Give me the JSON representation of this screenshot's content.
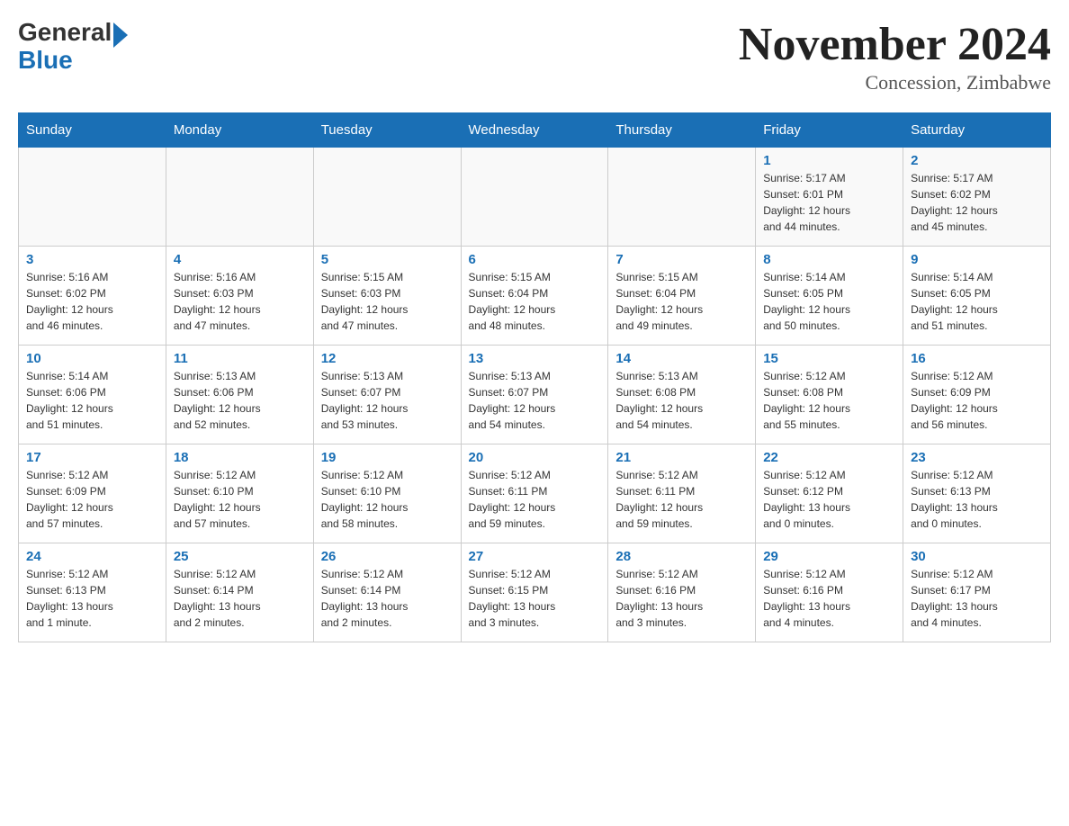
{
  "header": {
    "logo_general": "General",
    "logo_blue": "Blue",
    "month_title": "November 2024",
    "location": "Concession, Zimbabwe"
  },
  "weekdays": [
    "Sunday",
    "Monday",
    "Tuesday",
    "Wednesday",
    "Thursday",
    "Friday",
    "Saturday"
  ],
  "weeks": [
    [
      {
        "day": "",
        "info": ""
      },
      {
        "day": "",
        "info": ""
      },
      {
        "day": "",
        "info": ""
      },
      {
        "day": "",
        "info": ""
      },
      {
        "day": "",
        "info": ""
      },
      {
        "day": "1",
        "info": "Sunrise: 5:17 AM\nSunset: 6:01 PM\nDaylight: 12 hours\nand 44 minutes."
      },
      {
        "day": "2",
        "info": "Sunrise: 5:17 AM\nSunset: 6:02 PM\nDaylight: 12 hours\nand 45 minutes."
      }
    ],
    [
      {
        "day": "3",
        "info": "Sunrise: 5:16 AM\nSunset: 6:02 PM\nDaylight: 12 hours\nand 46 minutes."
      },
      {
        "day": "4",
        "info": "Sunrise: 5:16 AM\nSunset: 6:03 PM\nDaylight: 12 hours\nand 47 minutes."
      },
      {
        "day": "5",
        "info": "Sunrise: 5:15 AM\nSunset: 6:03 PM\nDaylight: 12 hours\nand 47 minutes."
      },
      {
        "day": "6",
        "info": "Sunrise: 5:15 AM\nSunset: 6:04 PM\nDaylight: 12 hours\nand 48 minutes."
      },
      {
        "day": "7",
        "info": "Sunrise: 5:15 AM\nSunset: 6:04 PM\nDaylight: 12 hours\nand 49 minutes."
      },
      {
        "day": "8",
        "info": "Sunrise: 5:14 AM\nSunset: 6:05 PM\nDaylight: 12 hours\nand 50 minutes."
      },
      {
        "day": "9",
        "info": "Sunrise: 5:14 AM\nSunset: 6:05 PM\nDaylight: 12 hours\nand 51 minutes."
      }
    ],
    [
      {
        "day": "10",
        "info": "Sunrise: 5:14 AM\nSunset: 6:06 PM\nDaylight: 12 hours\nand 51 minutes."
      },
      {
        "day": "11",
        "info": "Sunrise: 5:13 AM\nSunset: 6:06 PM\nDaylight: 12 hours\nand 52 minutes."
      },
      {
        "day": "12",
        "info": "Sunrise: 5:13 AM\nSunset: 6:07 PM\nDaylight: 12 hours\nand 53 minutes."
      },
      {
        "day": "13",
        "info": "Sunrise: 5:13 AM\nSunset: 6:07 PM\nDaylight: 12 hours\nand 54 minutes."
      },
      {
        "day": "14",
        "info": "Sunrise: 5:13 AM\nSunset: 6:08 PM\nDaylight: 12 hours\nand 54 minutes."
      },
      {
        "day": "15",
        "info": "Sunrise: 5:12 AM\nSunset: 6:08 PM\nDaylight: 12 hours\nand 55 minutes."
      },
      {
        "day": "16",
        "info": "Sunrise: 5:12 AM\nSunset: 6:09 PM\nDaylight: 12 hours\nand 56 minutes."
      }
    ],
    [
      {
        "day": "17",
        "info": "Sunrise: 5:12 AM\nSunset: 6:09 PM\nDaylight: 12 hours\nand 57 minutes."
      },
      {
        "day": "18",
        "info": "Sunrise: 5:12 AM\nSunset: 6:10 PM\nDaylight: 12 hours\nand 57 minutes."
      },
      {
        "day": "19",
        "info": "Sunrise: 5:12 AM\nSunset: 6:10 PM\nDaylight: 12 hours\nand 58 minutes."
      },
      {
        "day": "20",
        "info": "Sunrise: 5:12 AM\nSunset: 6:11 PM\nDaylight: 12 hours\nand 59 minutes."
      },
      {
        "day": "21",
        "info": "Sunrise: 5:12 AM\nSunset: 6:11 PM\nDaylight: 12 hours\nand 59 minutes."
      },
      {
        "day": "22",
        "info": "Sunrise: 5:12 AM\nSunset: 6:12 PM\nDaylight: 13 hours\nand 0 minutes."
      },
      {
        "day": "23",
        "info": "Sunrise: 5:12 AM\nSunset: 6:13 PM\nDaylight: 13 hours\nand 0 minutes."
      }
    ],
    [
      {
        "day": "24",
        "info": "Sunrise: 5:12 AM\nSunset: 6:13 PM\nDaylight: 13 hours\nand 1 minute."
      },
      {
        "day": "25",
        "info": "Sunrise: 5:12 AM\nSunset: 6:14 PM\nDaylight: 13 hours\nand 2 minutes."
      },
      {
        "day": "26",
        "info": "Sunrise: 5:12 AM\nSunset: 6:14 PM\nDaylight: 13 hours\nand 2 minutes."
      },
      {
        "day": "27",
        "info": "Sunrise: 5:12 AM\nSunset: 6:15 PM\nDaylight: 13 hours\nand 3 minutes."
      },
      {
        "day": "28",
        "info": "Sunrise: 5:12 AM\nSunset: 6:16 PM\nDaylight: 13 hours\nand 3 minutes."
      },
      {
        "day": "29",
        "info": "Sunrise: 5:12 AM\nSunset: 6:16 PM\nDaylight: 13 hours\nand 4 minutes."
      },
      {
        "day": "30",
        "info": "Sunrise: 5:12 AM\nSunset: 6:17 PM\nDaylight: 13 hours\nand 4 minutes."
      }
    ]
  ]
}
